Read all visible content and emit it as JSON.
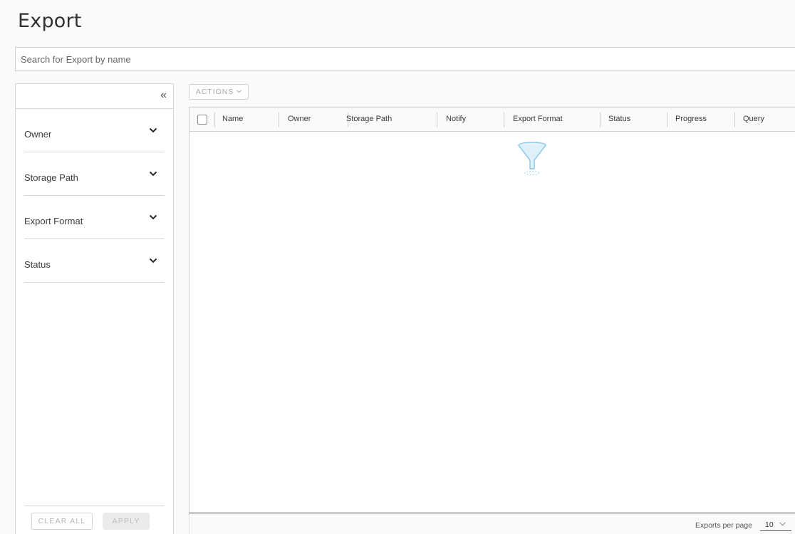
{
  "page": {
    "title": "Export"
  },
  "search": {
    "placeholder": "Search for Export by name"
  },
  "sidebar": {
    "collapse_glyph": "«",
    "filters": [
      {
        "label": "Owner"
      },
      {
        "label": "Storage Path"
      },
      {
        "label": "Export Format"
      },
      {
        "label": "Status"
      }
    ],
    "clear_label": "CLEAR ALL",
    "apply_label": "APPLY"
  },
  "toolbar": {
    "actions_label": "ACTIONS"
  },
  "grid": {
    "columns": [
      "Name",
      "Owner",
      "Storage Path",
      "Notify",
      "Export Format",
      "Status",
      "Progress",
      "Query"
    ]
  },
  "footer": {
    "per_page_label": "Exports per page",
    "per_page_value": "10"
  },
  "icons": {
    "collapse": "double-chevron-left-icon",
    "filter_chevron": "chevron-down-icon",
    "empty_state": "funnel-icon"
  },
  "colors": {
    "accent": "#8fc7e8",
    "border": "#cfcfcf"
  }
}
